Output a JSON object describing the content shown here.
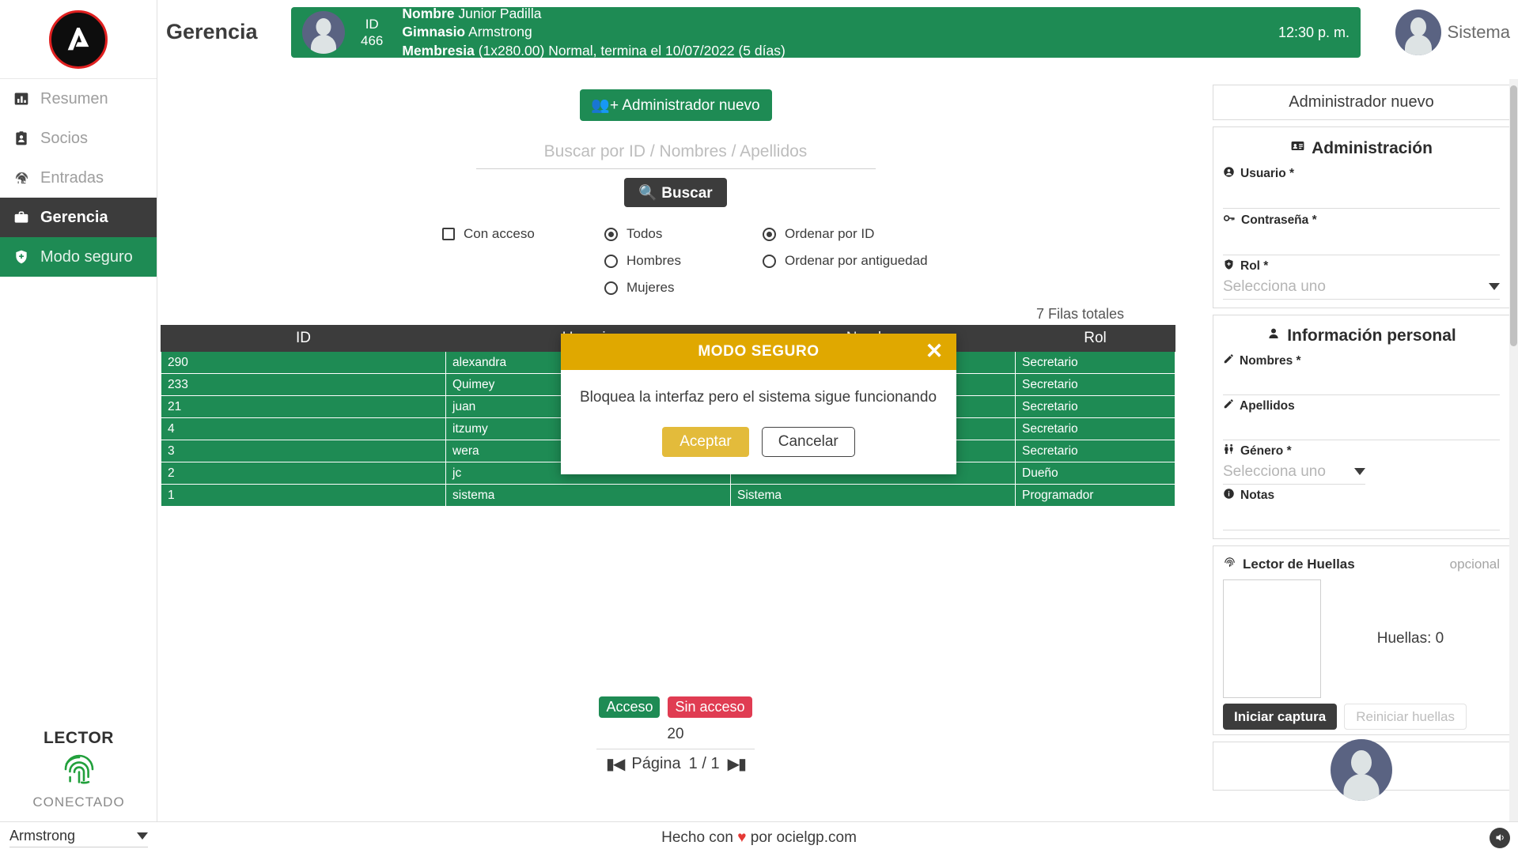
{
  "colors": {
    "green": "#1e8b54",
    "dark": "#3c3c3c",
    "amber": "#e0a800",
    "red": "#e03c52",
    "logo_ring": "#e02020"
  },
  "sidebar": {
    "logo_letter": "A",
    "items": [
      {
        "label": "Resumen",
        "icon": "chart-bar-icon",
        "state": "normal"
      },
      {
        "label": "Socios",
        "icon": "id-badge-icon",
        "state": "normal"
      },
      {
        "label": "Entradas",
        "icon": "fingerprint-icon",
        "state": "normal"
      },
      {
        "label": "Gerencia",
        "icon": "briefcase-icon",
        "state": "active"
      },
      {
        "label": "Modo seguro",
        "icon": "shield-icon",
        "state": "safe"
      }
    ],
    "reader": {
      "title": "LECTOR",
      "status": "CONECTADO",
      "icon": "fingerprint-icon"
    }
  },
  "header": {
    "page_title": "Gerencia",
    "member": {
      "id_label": "ID",
      "id_value": "466",
      "nombre_label": "Nombre",
      "nombre_value": "Junior Padilla",
      "gimnasio_label": "Gimnasio",
      "gimnasio_value": "Armstrong",
      "membresia_label": "Membresia",
      "membresia_value": "(1x280.00) Normal, termina el 10/07/2022 (5 días)"
    },
    "time": "12:30 p. m.",
    "user_name": "Sistema"
  },
  "toolbar": {
    "new_admin_label": "Administrador nuevo",
    "new_admin_icon": "person-add-icon",
    "search_placeholder": "Buscar por ID / Nombres / Apellidos",
    "search_value": "",
    "search_button_label": "Buscar",
    "search_button_icon": "search-icon"
  },
  "filters": {
    "access_checkbox": {
      "label": "Con acceso",
      "checked": false
    },
    "gender_group": [
      {
        "label": "Todos",
        "selected": true
      },
      {
        "label": "Hombres",
        "selected": false
      },
      {
        "label": "Mujeres",
        "selected": false
      }
    ],
    "order_group": [
      {
        "label": "Ordenar por ID",
        "selected": true
      },
      {
        "label": "Ordenar por antiguedad",
        "selected": false
      }
    ]
  },
  "table": {
    "total_rows_label": "7 Filas totales",
    "columns": [
      "ID",
      "Usuario",
      "Nombre",
      "Rol"
    ],
    "rows": [
      [
        "290",
        "alexandra",
        "",
        "Secretario"
      ],
      [
        "233",
        "Quimey",
        "",
        "Secretario"
      ],
      [
        "21",
        "juan",
        "",
        "Secretario"
      ],
      [
        "4",
        "itzumy",
        "",
        "Secretario"
      ],
      [
        "3",
        "wera",
        "",
        "Secretario"
      ],
      [
        "2",
        "jc",
        "",
        "Dueño"
      ],
      [
        "1",
        "sistema",
        "Sistema",
        "Programador"
      ]
    ]
  },
  "legend": {
    "access_tag": "Acceso",
    "no_access_tag": "Sin acceso",
    "per_page": "20",
    "page_label": "Página",
    "page_value": "1 / 1",
    "first_icon": "first-page-icon",
    "last_icon": "last-page-icon"
  },
  "right_panel": {
    "card_title": "Administrador nuevo",
    "administration": {
      "section_title": "Administración",
      "section_icon": "id-card-icon",
      "fields": [
        {
          "label": "Usuario *",
          "icon": "user-circle-icon",
          "value": "",
          "type": "text"
        },
        {
          "label": "Contraseña *",
          "icon": "key-icon",
          "value": "",
          "type": "text"
        },
        {
          "label": "Rol *",
          "icon": "shield-icon",
          "value": "",
          "type": "select",
          "placeholder": "Selecciona uno"
        }
      ]
    },
    "personal": {
      "section_title": "Información personal",
      "section_icon": "person-icon",
      "fields": [
        {
          "label": "Nombres *",
          "icon": "pencil-icon",
          "value": "",
          "type": "text"
        },
        {
          "label": "Apellidos",
          "icon": "pencil-icon",
          "value": "",
          "type": "text"
        },
        {
          "label": "Género *",
          "icon": "gender-icon",
          "value": "",
          "type": "select",
          "placeholder": "Selecciona uno"
        },
        {
          "label": "Notas",
          "icon": "info-icon",
          "value": "",
          "type": "text"
        }
      ]
    },
    "fingerprint": {
      "title": "Lector de Huellas",
      "icon": "fingerprint-icon",
      "optional_label": "opcional",
      "count_label": "Huellas: 0",
      "start_button": "Iniciar captura",
      "reset_button": "Reiniciar huellas"
    }
  },
  "modal": {
    "title": "MODO SEGURO",
    "close_icon": "close-icon",
    "message": "Bloquea la interfaz pero el sistema sigue funcionando",
    "accept_label": "Aceptar",
    "cancel_label": "Cancelar"
  },
  "footer": {
    "gym_selected": "Armstrong",
    "made_with_prefix": "Hecho con ",
    "heart": "♥",
    "made_with_suffix": " por ocielgp.com",
    "sound_icon": "speaker-icon"
  }
}
